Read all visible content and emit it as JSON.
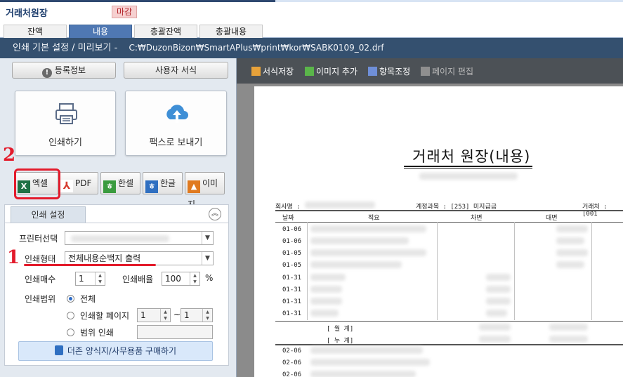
{
  "window": {
    "title": "거래처원장",
    "badge": "마감"
  },
  "tabs": [
    {
      "label": "잔액"
    },
    {
      "label": "내용"
    },
    {
      "label": "총괄잔액"
    },
    {
      "label": "총괄내용"
    }
  ],
  "header": {
    "title": "인쇄 기본 설정 / 미리보기 -",
    "path": "C:₩DuzonBizon₩SmartAPlus₩print₩kor₩SABK0109_02.drf"
  },
  "left": {
    "reg_info_label": "등록정보",
    "user_format_label": "사용자 서식",
    "print_label": "인쇄하기",
    "fax_label": "팩스로 보내기",
    "export": [
      {
        "label": "엑셀",
        "icon": "excel-icon",
        "color": "#1e7145"
      },
      {
        "label": "PDF",
        "icon": "pdf-icon",
        "color": "#d63b2f"
      },
      {
        "label": "한셀",
        "icon": "hancell-icon",
        "color": "#3a9b3f"
      },
      {
        "label": "한글",
        "icon": "hangul-icon",
        "color": "#2f6fc1"
      },
      {
        "label": "이미지",
        "icon": "image-icon",
        "color": "#e07a20"
      }
    ],
    "settings_tab": "인쇄 설정",
    "printer_label": "프린터선택",
    "print_type_label": "인쇄형태",
    "print_type_value": "전체내용순백지 출력",
    "copies_label": "인쇄매수",
    "copies_value": "1",
    "scale_label": "인쇄배율",
    "scale_value": "100",
    "scale_unit": "%",
    "range_label": "인쇄범위",
    "range_all": "전체",
    "range_pages": "인쇄할 페이지",
    "page_from": "1",
    "page_sep": "~",
    "page_to": "1",
    "range_custom": "범위 인쇄",
    "buy_label": "더존 양식지/사무용품 구매하기"
  },
  "annotations": {
    "mark1": "1",
    "mark2": "2"
  },
  "toolbar": {
    "save_format": "서식저장",
    "add_image": "이미지 추가",
    "adjust_items": "항목조정",
    "page_edit": "페이지 편집"
  },
  "document": {
    "title": "거래처 원장(내용)",
    "company_label": "회사명 :",
    "account_label": "계정과목 : [253] 미지급금",
    "partner_label": "거래처 : [001",
    "col_date": "날짜",
    "col_desc": "적요",
    "col_debit": "차변",
    "col_credit": "대변",
    "rows": [
      "01-06",
      "01-06",
      "01-05",
      "01-05",
      "01-31",
      "01-31",
      "01-31",
      "01-31"
    ],
    "subtotal_month": "[ 월      계]",
    "subtotal_cum": "[ 누      계]",
    "rows2": [
      "02-06",
      "02-06",
      "02-06"
    ]
  }
}
